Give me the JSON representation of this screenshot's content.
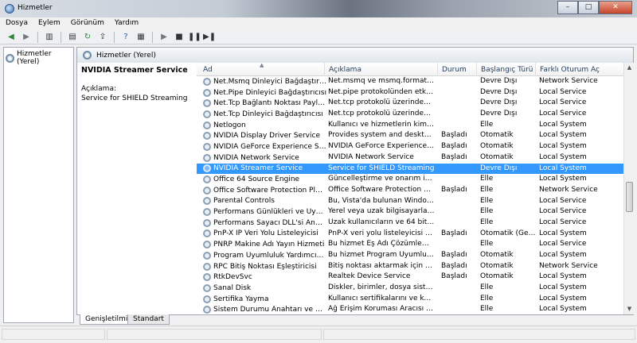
{
  "window": {
    "title": "Hizmetler",
    "minimize": "–",
    "maximize": "□",
    "close": "✕"
  },
  "menu": [
    {
      "label": "Dosya"
    },
    {
      "label": "Eylem"
    },
    {
      "label": "Görünüm"
    },
    {
      "label": "Yardım"
    }
  ],
  "toolbar": {
    "back": "◀",
    "forward": "▶",
    "up": "▥",
    "properties": "▤",
    "refresh": "↻",
    "export": "⇪",
    "help": "?",
    "view": "▦",
    "start": "▶",
    "stop": "■",
    "pause": "❚❚",
    "restart": "▶❚"
  },
  "tree": {
    "root_label": "Hizmetler (Yerel)"
  },
  "header": {
    "title": "Hizmetler (Yerel)"
  },
  "detail": {
    "service_name": "NVIDIA Streamer Service",
    "description_label": "Açıklama:",
    "description": "Service for SHIELD Streaming"
  },
  "columns": {
    "name": "Ad",
    "description": "Açıklama",
    "status": "Durum",
    "startup": "Başlangıç Türü",
    "logon": "Farklı Oturum Aç"
  },
  "services": [
    {
      "name": "Net.Msmq Dinleyici Bağdaştırıcısı",
      "desc": "Net.msmq ve msmq.formatnam...",
      "status": "",
      "start": "Devre Dışı",
      "logon": "Network Service"
    },
    {
      "name": "Net.Pipe Dinleyici Bağdaştırıcısı",
      "desc": "Net.pipe protokolünden etkinleşt...",
      "status": "",
      "start": "Devre Dışı",
      "logon": "Local Service"
    },
    {
      "name": "Net.Tcp Bağlantı Noktası Paylaştır...",
      "desc": "Net.tcp protokolü üzerinden TCP...",
      "status": "",
      "start": "Devre Dışı",
      "logon": "Local Service"
    },
    {
      "name": "Net.Tcp Dinleyici Bağdaştırıcısı",
      "desc": "Net.tcp protokolü üzerinden etk...",
      "status": "",
      "start": "Devre Dışı",
      "logon": "Local Service"
    },
    {
      "name": "Netlogon",
      "desc": "Kullanıcı ve hizmetlerin kimlik do...",
      "status": "",
      "start": "Elle",
      "logon": "Local System"
    },
    {
      "name": "NVIDIA Display Driver Service",
      "desc": "Provides system and desktop lev...",
      "status": "Başladı",
      "start": "Otomatik",
      "logon": "Local System"
    },
    {
      "name": "NVIDIA GeForce Experience Service",
      "desc": "NVIDIA GeForce Experience Service",
      "status": "Başladı",
      "start": "Otomatik",
      "logon": "Local System"
    },
    {
      "name": "NVIDIA Network Service",
      "desc": "NVIDIA Network Service",
      "status": "Başladı",
      "start": "Otomatik",
      "logon": "Local System"
    },
    {
      "name": "NVIDIA Streamer Service",
      "desc": "Service for SHIELD Streaming",
      "status": "",
      "start": "Devre Dışı",
      "logon": "Local System",
      "selected": true
    },
    {
      "name": "Office 64 Source Engine",
      "desc": "Güncelleştirme ve onarım için kul...",
      "status": "",
      "start": "Elle",
      "logon": "Local System"
    },
    {
      "name": "Office Software Protection Platform",
      "desc": "Office Software Protection Platfo...",
      "status": "Başladı",
      "start": "Elle",
      "logon": "Network Service"
    },
    {
      "name": "Parental Controls",
      "desc": "Bu, Vista'da bulunan Windows Eb...",
      "status": "",
      "start": "Elle",
      "logon": "Local Service"
    },
    {
      "name": "Performans Günlükleri ve Uyarıları",
      "desc": "Yerel veya uzak bilgisayarlardaki ...",
      "status": "",
      "start": "Elle",
      "logon": "Local Service"
    },
    {
      "name": "Performans Sayacı DLL'si Ana Bilgi...",
      "desc": "Uzak kullanıcıların ve 64 bit işlem...",
      "status": "",
      "start": "Elle",
      "logon": "Local Service"
    },
    {
      "name": "PnP-X IP Veri Yolu Listeleyicisi",
      "desc": "PnP-X veri yolu listeleyicisi hizme...",
      "status": "Başladı",
      "start": "Otomatik (Geci...",
      "logon": "Local System"
    },
    {
      "name": "PNRP Makine Adı Yayın Hizmeti",
      "desc": "Bu hizmet Eş Adı Çözümleme Prot...",
      "status": "",
      "start": "Elle",
      "logon": "Local Service"
    },
    {
      "name": "Program Uyumluluk Yardımcısı Hi...",
      "desc": "Bu hizmet Program Uyumluluk Y...",
      "status": "Başladı",
      "start": "Otomatik",
      "logon": "Local System"
    },
    {
      "name": "RPC Bitiş Noktası Eşleştiricisi",
      "desc": "Bitiş noktası aktarmak için RPC ar...",
      "status": "Başladı",
      "start": "Otomatik",
      "logon": "Network Service"
    },
    {
      "name": "RtkDevSvc",
      "desc": "Realtek Device Service",
      "status": "Başladı",
      "start": "Otomatik",
      "logon": "Local System"
    },
    {
      "name": "Sanal Disk",
      "desc": "Diskler, birimler, dosya sistemleri ...",
      "status": "",
      "start": "Elle",
      "logon": "Local System"
    },
    {
      "name": "Sertifika Yayma",
      "desc": "Kullanıcı sertifikalarını ve kök sert...",
      "status": "",
      "start": "Elle",
      "logon": "Local System"
    },
    {
      "name": "Sistem Durumu Anahtarı ve Sertifi...",
      "desc": "Ağ Erişim Koruması Aracısı (NAP)...",
      "status": "",
      "start": "Elle",
      "logon": "Local System"
    }
  ],
  "tabs": [
    {
      "label": "Genişletilmiş"
    },
    {
      "label": "Standart"
    }
  ]
}
